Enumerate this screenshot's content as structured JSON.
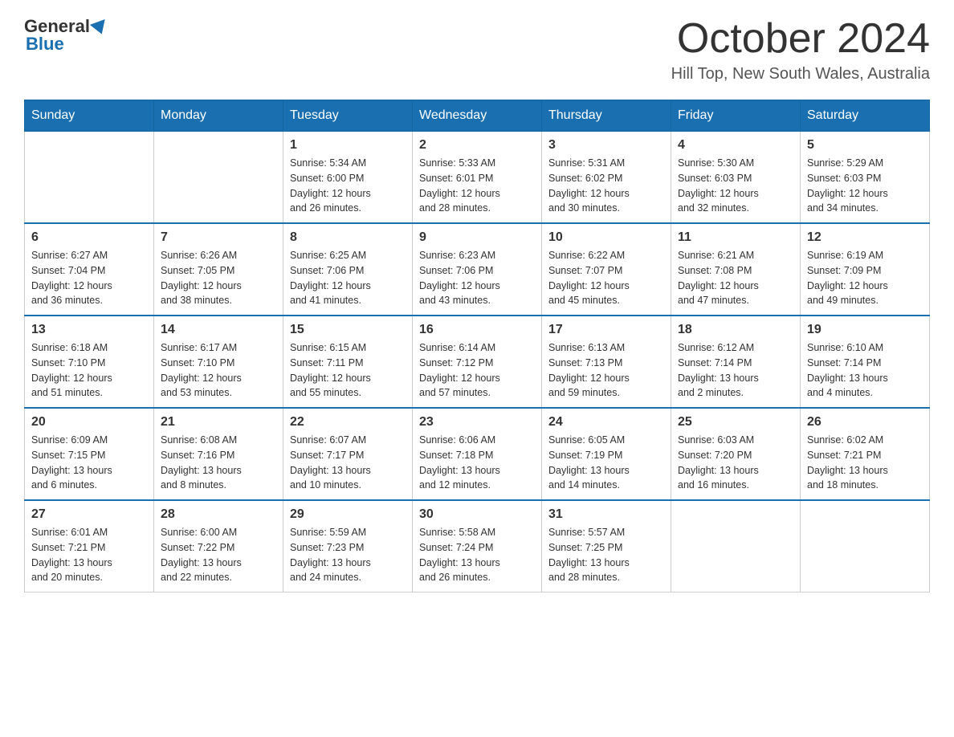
{
  "logo": {
    "general": "General",
    "blue": "Blue"
  },
  "header": {
    "month": "October 2024",
    "location": "Hill Top, New South Wales, Australia"
  },
  "days_of_week": [
    "Sunday",
    "Monday",
    "Tuesday",
    "Wednesday",
    "Thursday",
    "Friday",
    "Saturday"
  ],
  "weeks": [
    [
      {
        "day": "",
        "info": ""
      },
      {
        "day": "",
        "info": ""
      },
      {
        "day": "1",
        "info": "Sunrise: 5:34 AM\nSunset: 6:00 PM\nDaylight: 12 hours\nand 26 minutes."
      },
      {
        "day": "2",
        "info": "Sunrise: 5:33 AM\nSunset: 6:01 PM\nDaylight: 12 hours\nand 28 minutes."
      },
      {
        "day": "3",
        "info": "Sunrise: 5:31 AM\nSunset: 6:02 PM\nDaylight: 12 hours\nand 30 minutes."
      },
      {
        "day": "4",
        "info": "Sunrise: 5:30 AM\nSunset: 6:03 PM\nDaylight: 12 hours\nand 32 minutes."
      },
      {
        "day": "5",
        "info": "Sunrise: 5:29 AM\nSunset: 6:03 PM\nDaylight: 12 hours\nand 34 minutes."
      }
    ],
    [
      {
        "day": "6",
        "info": "Sunrise: 6:27 AM\nSunset: 7:04 PM\nDaylight: 12 hours\nand 36 minutes."
      },
      {
        "day": "7",
        "info": "Sunrise: 6:26 AM\nSunset: 7:05 PM\nDaylight: 12 hours\nand 38 minutes."
      },
      {
        "day": "8",
        "info": "Sunrise: 6:25 AM\nSunset: 7:06 PM\nDaylight: 12 hours\nand 41 minutes."
      },
      {
        "day": "9",
        "info": "Sunrise: 6:23 AM\nSunset: 7:06 PM\nDaylight: 12 hours\nand 43 minutes."
      },
      {
        "day": "10",
        "info": "Sunrise: 6:22 AM\nSunset: 7:07 PM\nDaylight: 12 hours\nand 45 minutes."
      },
      {
        "day": "11",
        "info": "Sunrise: 6:21 AM\nSunset: 7:08 PM\nDaylight: 12 hours\nand 47 minutes."
      },
      {
        "day": "12",
        "info": "Sunrise: 6:19 AM\nSunset: 7:09 PM\nDaylight: 12 hours\nand 49 minutes."
      }
    ],
    [
      {
        "day": "13",
        "info": "Sunrise: 6:18 AM\nSunset: 7:10 PM\nDaylight: 12 hours\nand 51 minutes."
      },
      {
        "day": "14",
        "info": "Sunrise: 6:17 AM\nSunset: 7:10 PM\nDaylight: 12 hours\nand 53 minutes."
      },
      {
        "day": "15",
        "info": "Sunrise: 6:15 AM\nSunset: 7:11 PM\nDaylight: 12 hours\nand 55 minutes."
      },
      {
        "day": "16",
        "info": "Sunrise: 6:14 AM\nSunset: 7:12 PM\nDaylight: 12 hours\nand 57 minutes."
      },
      {
        "day": "17",
        "info": "Sunrise: 6:13 AM\nSunset: 7:13 PM\nDaylight: 12 hours\nand 59 minutes."
      },
      {
        "day": "18",
        "info": "Sunrise: 6:12 AM\nSunset: 7:14 PM\nDaylight: 13 hours\nand 2 minutes."
      },
      {
        "day": "19",
        "info": "Sunrise: 6:10 AM\nSunset: 7:14 PM\nDaylight: 13 hours\nand 4 minutes."
      }
    ],
    [
      {
        "day": "20",
        "info": "Sunrise: 6:09 AM\nSunset: 7:15 PM\nDaylight: 13 hours\nand 6 minutes."
      },
      {
        "day": "21",
        "info": "Sunrise: 6:08 AM\nSunset: 7:16 PM\nDaylight: 13 hours\nand 8 minutes."
      },
      {
        "day": "22",
        "info": "Sunrise: 6:07 AM\nSunset: 7:17 PM\nDaylight: 13 hours\nand 10 minutes."
      },
      {
        "day": "23",
        "info": "Sunrise: 6:06 AM\nSunset: 7:18 PM\nDaylight: 13 hours\nand 12 minutes."
      },
      {
        "day": "24",
        "info": "Sunrise: 6:05 AM\nSunset: 7:19 PM\nDaylight: 13 hours\nand 14 minutes."
      },
      {
        "day": "25",
        "info": "Sunrise: 6:03 AM\nSunset: 7:20 PM\nDaylight: 13 hours\nand 16 minutes."
      },
      {
        "day": "26",
        "info": "Sunrise: 6:02 AM\nSunset: 7:21 PM\nDaylight: 13 hours\nand 18 minutes."
      }
    ],
    [
      {
        "day": "27",
        "info": "Sunrise: 6:01 AM\nSunset: 7:21 PM\nDaylight: 13 hours\nand 20 minutes."
      },
      {
        "day": "28",
        "info": "Sunrise: 6:00 AM\nSunset: 7:22 PM\nDaylight: 13 hours\nand 22 minutes."
      },
      {
        "day": "29",
        "info": "Sunrise: 5:59 AM\nSunset: 7:23 PM\nDaylight: 13 hours\nand 24 minutes."
      },
      {
        "day": "30",
        "info": "Sunrise: 5:58 AM\nSunset: 7:24 PM\nDaylight: 13 hours\nand 26 minutes."
      },
      {
        "day": "31",
        "info": "Sunrise: 5:57 AM\nSunset: 7:25 PM\nDaylight: 13 hours\nand 28 minutes."
      },
      {
        "day": "",
        "info": ""
      },
      {
        "day": "",
        "info": ""
      }
    ]
  ]
}
